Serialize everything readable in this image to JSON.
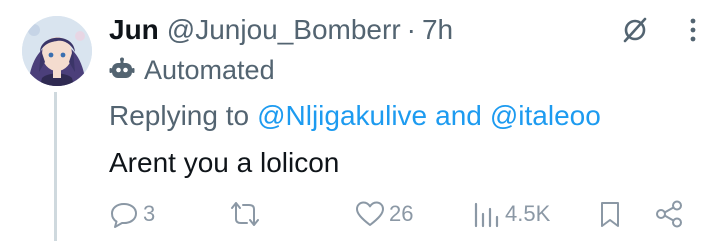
{
  "tweet": {
    "display_name": "Jun",
    "handle": "@Junjou_Bomberr",
    "separator": "·",
    "time": "7h",
    "automated_label": "Automated",
    "replying_prefix": "Replying to",
    "reply_mentions": [
      "@Nljigakulive",
      "and",
      "@italeoo"
    ],
    "text": "Arent you a lolicon"
  },
  "actions": {
    "reply_count": "3",
    "like_count": "26",
    "views_count": "4.5K"
  },
  "icons": {
    "top": [
      "grok-icon",
      "more-options-icon"
    ],
    "badge": "bot-icon",
    "actions": [
      "reply-icon",
      "retweet-icon",
      "like-icon",
      "views-icon",
      "bookmark-icon",
      "share-icon"
    ]
  },
  "colors": {
    "text": "#0f1419",
    "secondary": "#536471",
    "link": "#1d9bf0",
    "action_gray": "#8b98a5",
    "thread_line": "#cfd9de"
  }
}
